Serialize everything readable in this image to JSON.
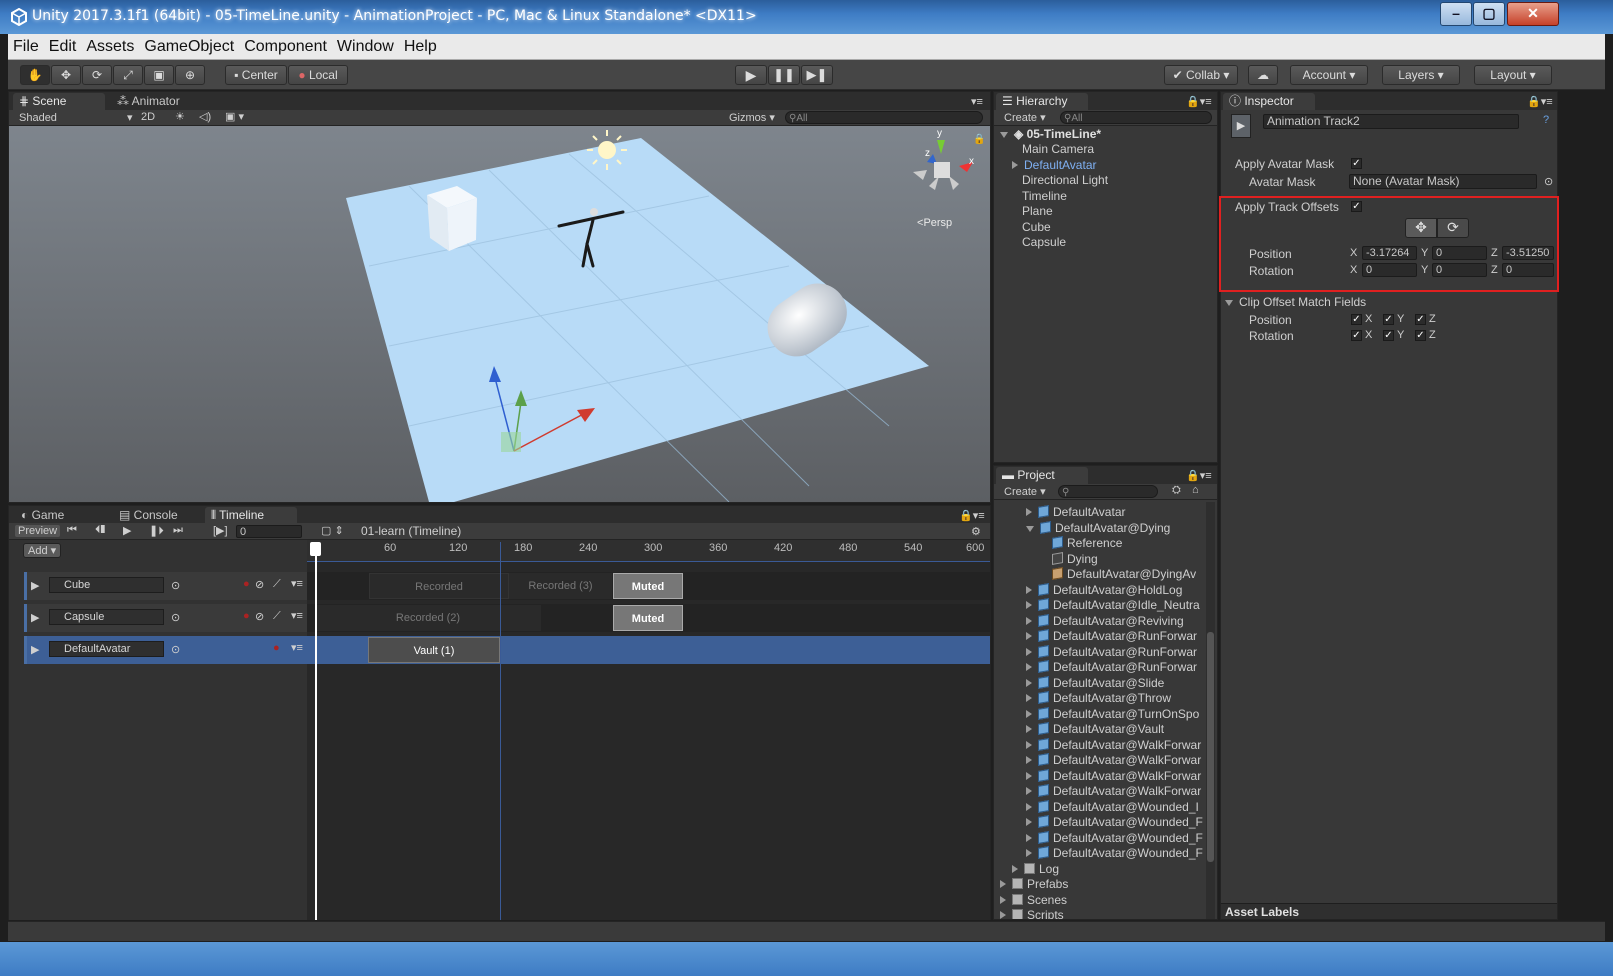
{
  "window": {
    "title": "Unity 2017.3.1f1 (64bit) - 05-TimeLine.unity - AnimationProject - PC, Mac & Linux Standalone* <DX11>"
  },
  "menu": [
    "File",
    "Edit",
    "Assets",
    "GameObject",
    "Component",
    "Window",
    "Help"
  ],
  "toolbar": {
    "center": "Center",
    "local": "Local",
    "collab": "Collab",
    "account": "Account",
    "layers": "Layers",
    "layout": "Layout"
  },
  "scene": {
    "tab_scene": "Scene",
    "tab_animator": "Animator",
    "shading": "Shaded",
    "mode2d": "2D",
    "gizmos": "Gizmos",
    "search_placeholder": "All",
    "persp": "Persp",
    "gizmo_x": "x",
    "gizmo_y": "y",
    "gizmo_z": "z"
  },
  "hierarchy": {
    "tab": "Hierarchy",
    "create": "Create",
    "search_placeholder": "All",
    "scene_name": "05-TimeLine*",
    "items": [
      "Main Camera",
      "DefaultAvatar",
      "Directional Light",
      "Timeline",
      "Plane",
      "Cube",
      "Capsule"
    ]
  },
  "inspector": {
    "tab": "Inspector",
    "object_name": "Animation Track2",
    "apply_avatar_mask": "Apply Avatar Mask",
    "avatar_mask": "Avatar Mask",
    "avatar_mask_value": "None (Avatar Mask)",
    "apply_track_offsets": "Apply Track Offsets",
    "position": "Position",
    "rotation": "Rotation",
    "pos_x": "-3.17264",
    "pos_y": "0",
    "pos_z": "-3.51250",
    "rot_x": "0",
    "rot_y": "0",
    "rot_z": "0",
    "clip_offset": "Clip Offset Match Fields",
    "x": "X",
    "y": "Y",
    "z": "Z",
    "asset_labels": "Asset Labels"
  },
  "project": {
    "tab": "Project",
    "create": "Create",
    "items": [
      "DefaultAvatar",
      "DefaultAvatar@Dying",
      "Reference",
      "Dying",
      "DefaultAvatar@DyingAv",
      "DefaultAvatar@HoldLog",
      "DefaultAvatar@Idle_Neutra",
      "DefaultAvatar@Reviving",
      "DefaultAvatar@RunForwar",
      "DefaultAvatar@RunForwar",
      "DefaultAvatar@RunForwar",
      "DefaultAvatar@Slide",
      "DefaultAvatar@Throw",
      "DefaultAvatar@TurnOnSpo",
      "DefaultAvatar@Vault",
      "DefaultAvatar@WalkForwar",
      "DefaultAvatar@WalkForwar",
      "DefaultAvatar@WalkForwar",
      "DefaultAvatar@WalkForwar",
      "DefaultAvatar@Wounded_I",
      "DefaultAvatar@Wounded_F",
      "DefaultAvatar@Wounded_F",
      "DefaultAvatar@Wounded_F",
      "Log",
      "Prefabs",
      "Scenes",
      "Scripts"
    ]
  },
  "timeline": {
    "tab_game": "Game",
    "tab_console": "Console",
    "tab_timeline": "Timeline",
    "preview": "Preview",
    "frame": "0",
    "asset": "01-learn (Timeline)",
    "add": "Add",
    "ruler": [
      "60",
      "120",
      "180",
      "240",
      "300",
      "360",
      "420",
      "480",
      "540",
      "600"
    ],
    "tracks": [
      "Cube",
      "Capsule",
      "DefaultAvatar"
    ],
    "clips": {
      "rec1": "Recorded",
      "rec3": "Recorded (3)",
      "muted1": "Muted",
      "rec2": "Recorded (2)",
      "muted2": "Muted",
      "vault": "Vault (1)"
    }
  }
}
